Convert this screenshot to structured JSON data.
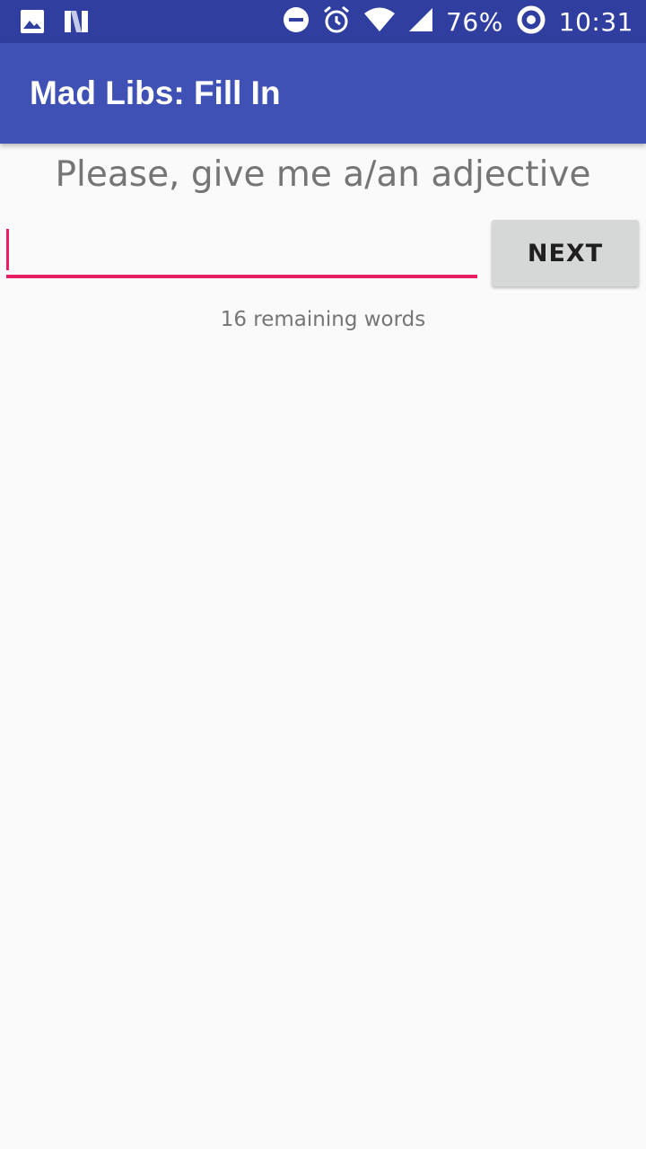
{
  "status_bar": {
    "battery": "76%",
    "time": "10:31",
    "icons": [
      "image-icon",
      "n-logo-icon",
      "do-not-disturb-icon",
      "alarm-icon",
      "wifi-icon",
      "signal-icon",
      "battery-ring-icon"
    ]
  },
  "app_bar": {
    "title": "Mad Libs: Fill In"
  },
  "main": {
    "prompt": "Please, give me a/an adjective",
    "input": {
      "value": "",
      "placeholder": ""
    },
    "next_label": "NEXT",
    "remaining": "16 remaining words"
  },
  "colors": {
    "status_bar": "#303f9f",
    "app_bar": "#3f51b5",
    "accent": "#e91e63",
    "background": "#fafafa",
    "button": "#d6d7d7"
  }
}
